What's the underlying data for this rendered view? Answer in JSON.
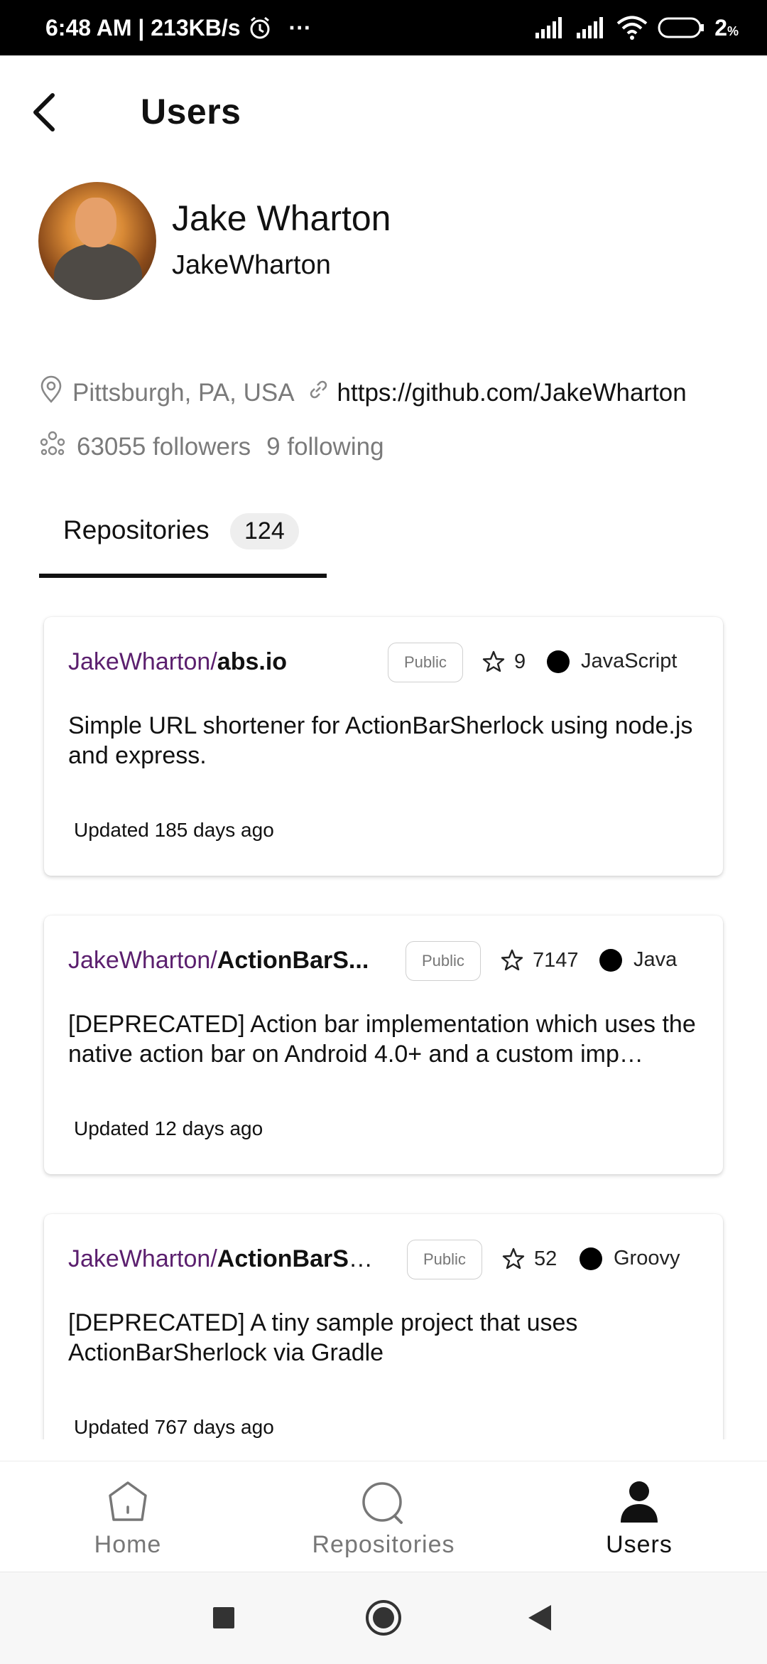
{
  "status_bar": {
    "time_speed": "6:48 AM | 213KB/s",
    "more": "···",
    "battery": "2"
  },
  "header": {
    "title": "Users"
  },
  "profile": {
    "name": "Jake Wharton",
    "login": "JakeWharton",
    "location": "Pittsburgh, PA, USA",
    "url": "https://github.com/JakeWharton",
    "followers": "63055 followers",
    "following": "9 following"
  },
  "tab": {
    "label": "Repositories",
    "count": "124"
  },
  "repos": [
    {
      "owner": "JakeWharton",
      "slash": "/",
      "name": "abs.io",
      "visibility": "Public",
      "stars": "9",
      "language": "JavaScript",
      "description": "Simple URL shortener for ActionBarSherlock using node.js and express.",
      "updated": "Updated 185 days ago"
    },
    {
      "owner": "JakeWharton",
      "slash": "/",
      "name": "ActionBarS...",
      "visibility": "Public",
      "stars": "7147",
      "language": "Java",
      "description": "[DEPRECATED] Action bar implementation which uses the native action bar on Android 4.0+ and a custom imp…",
      "updated": "Updated 12 days ago"
    },
    {
      "owner": "JakeWharton",
      "slash": "/",
      "name": "ActionBarSh...",
      "visibility": "Public",
      "stars": "52",
      "language": "Groovy",
      "description": "[DEPRECATED] A tiny sample project that uses ActionBarSherlock via Gradle",
      "updated": "Updated 767 days ago"
    }
  ],
  "bottom_nav": {
    "home": "Home",
    "repositories": "Repositories",
    "users": "Users"
  },
  "icons": {
    "back": "back-arrow-icon",
    "location": "location-pin-icon",
    "link": "link-icon",
    "followers": "people-icon",
    "star": "star-outline-icon",
    "home": "home-icon",
    "search": "search-icon",
    "user": "user-icon"
  },
  "colors": {
    "owner_link": "#5b1f6e",
    "status_bar": "#000000",
    "language_dot": "#000000"
  }
}
